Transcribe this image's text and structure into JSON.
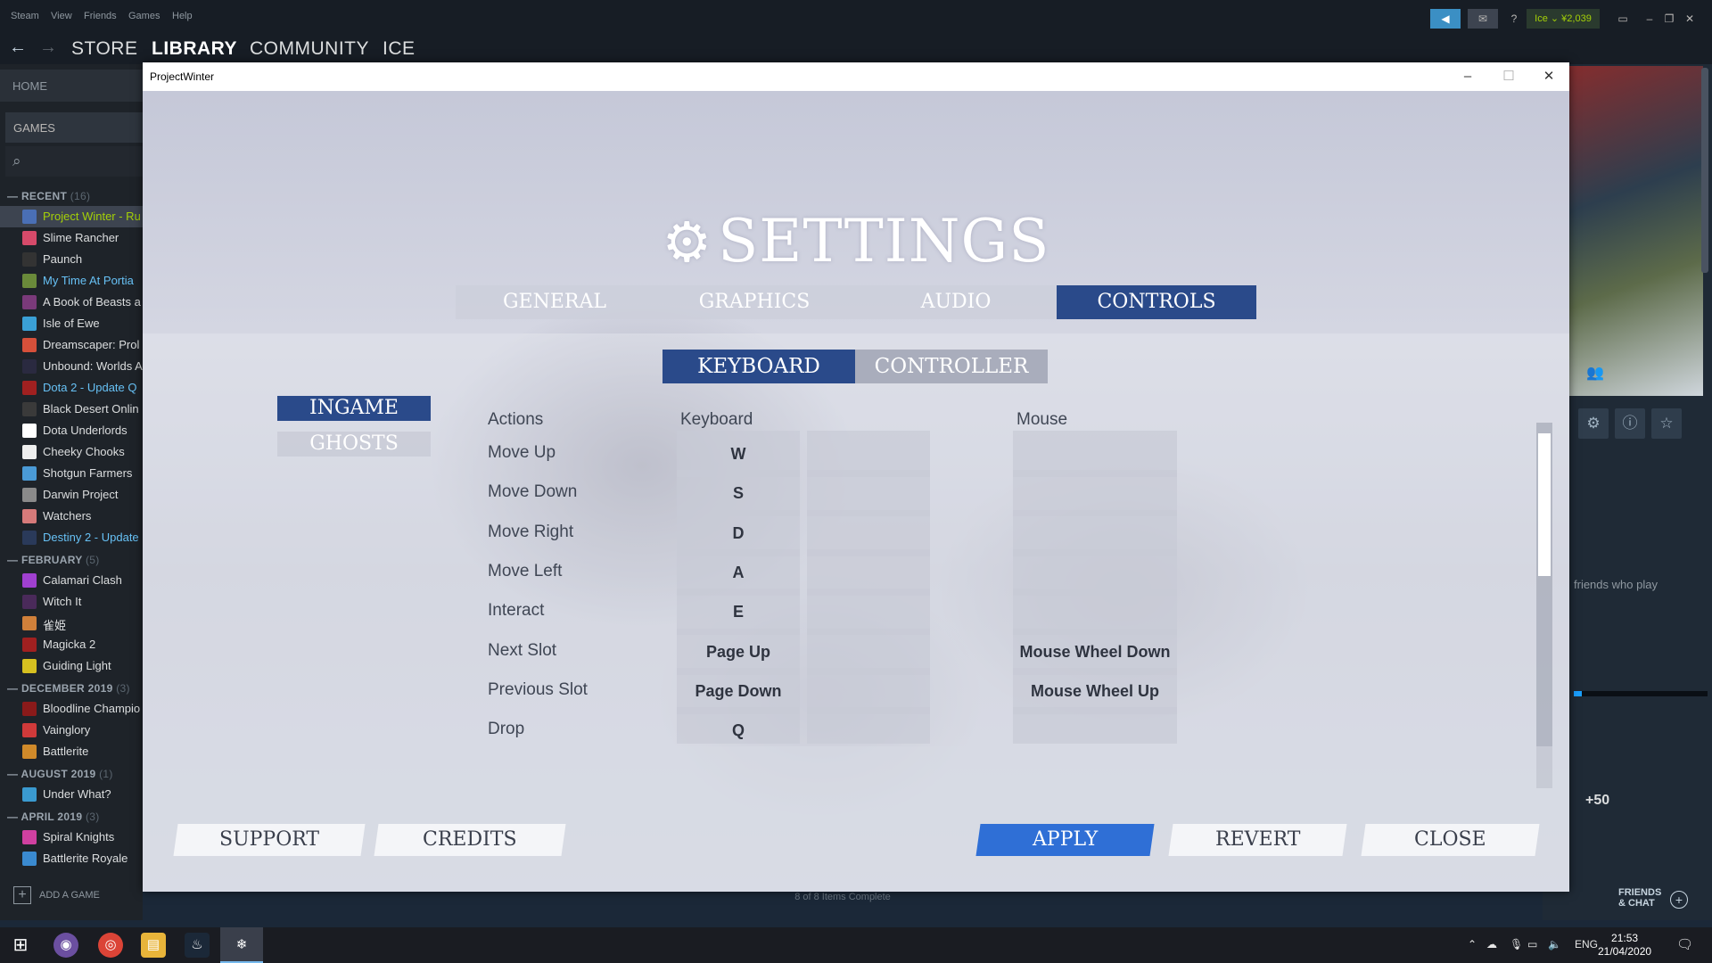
{
  "steam": {
    "menu": [
      "Steam",
      "View",
      "Friends",
      "Games",
      "Help"
    ],
    "nav": {
      "back": "←",
      "forward": "→",
      "store": "STORE",
      "library": "LIBRARY",
      "community": "COMMUNITY",
      "user": "ICE"
    },
    "account": {
      "help": "?",
      "user": "Ice ⌄ ¥2,039"
    },
    "window_controls": {
      "minimize": "–",
      "restore": "❐",
      "close": "✕"
    }
  },
  "sidebar": {
    "home": "HOME",
    "games": "GAMES",
    "search_icon": "⌕",
    "categories": [
      {
        "name": "RECENT",
        "count": "(16)",
        "games": [
          {
            "name": "Project Winter - Ru",
            "status": "running",
            "color": "#4a6fb5"
          },
          {
            "name": "Slime Rancher",
            "status": "",
            "color": "#d64a6a"
          },
          {
            "name": "Paunch",
            "status": "",
            "color": "#333333"
          },
          {
            "name": "My Time At Portia",
            "status": "update",
            "color": "#6a8a3a"
          },
          {
            "name": "A Book of Beasts a",
            "status": "",
            "color": "#7a3a7a"
          },
          {
            "name": "Isle of Ewe",
            "status": "",
            "color": "#3aa0d6"
          },
          {
            "name": "Dreamscaper: Prol",
            "status": "",
            "color": "#d6503a"
          },
          {
            "name": "Unbound: Worlds A",
            "status": "",
            "color": "#2a2a40"
          },
          {
            "name": "Dota 2 - Update Q",
            "status": "update",
            "color": "#a02020"
          },
          {
            "name": "Black Desert Onlin",
            "status": "",
            "color": "#3a3a3a"
          },
          {
            "name": "Dota Underlords",
            "status": "",
            "color": "#ffffff"
          },
          {
            "name": "Cheeky Chooks",
            "status": "",
            "color": "#eeeeee"
          },
          {
            "name": "Shotgun Farmers",
            "status": "",
            "color": "#4a9ad6"
          },
          {
            "name": "Darwin Project",
            "status": "",
            "color": "#8a8a8a"
          },
          {
            "name": "Watchers",
            "status": "",
            "color": "#d67a7a"
          },
          {
            "name": "Destiny 2 - Update",
            "status": "update",
            "color": "#2a3a5a"
          }
        ]
      },
      {
        "name": "FEBRUARY",
        "count": "(5)",
        "games": [
          {
            "name": "Calamari Clash",
            "status": "",
            "color": "#a040d0"
          },
          {
            "name": "Witch It",
            "status": "",
            "color": "#4a2a5a"
          },
          {
            "name": "雀姫",
            "status": "",
            "color": "#d0803a"
          },
          {
            "name": "Magicka 2",
            "status": "",
            "color": "#a02020"
          },
          {
            "name": "Guiding Light",
            "status": "",
            "color": "#d6c020"
          }
        ]
      },
      {
        "name": "DECEMBER 2019",
        "count": "(3)",
        "games": [
          {
            "name": "Bloodline Champio",
            "status": "",
            "color": "#8a1a1a"
          },
          {
            "name": "Vainglory",
            "status": "",
            "color": "#d03a3a"
          },
          {
            "name": "Battlerite",
            "status": "",
            "color": "#d08a2a"
          }
        ]
      },
      {
        "name": "AUGUST 2019",
        "count": "(1)",
        "games": [
          {
            "name": "Under What?",
            "status": "",
            "color": "#3a9ad0"
          }
        ]
      },
      {
        "name": "APRIL 2019",
        "count": "(3)",
        "games": [
          {
            "name": "Spiral Knights",
            "status": "",
            "color": "#d040a0"
          },
          {
            "name": "Battlerite Royale",
            "status": "",
            "color": "#3a8ad0"
          }
        ]
      }
    ],
    "add_game": "ADD A GAME"
  },
  "right_pane": {
    "friends_who_play": "friends who play",
    "plus_count": "+50",
    "friends_chat_line1": "FRIENDS",
    "friends_chat_line2": "& CHAT",
    "download_progress": 0.06
  },
  "status_bar": "8 of 8 Items Complete",
  "game_window": {
    "title": "ProjectWinter",
    "controls": {
      "minimize": "–",
      "maximize": "☐",
      "close": "✕"
    },
    "settings_title": "SETTINGS",
    "gear_icon": "⚙",
    "tabs": [
      "GENERAL",
      "GRAPHICS",
      "AUDIO",
      "CONTROLS"
    ],
    "active_tab": "CONTROLS",
    "subtabs": [
      "KEYBOARD",
      "CONTROLLER"
    ],
    "active_subtab": "KEYBOARD",
    "sidetabs": [
      "INGAME",
      "GHOSTS"
    ],
    "active_sidetab": "INGAME",
    "columns": {
      "actions": "Actions",
      "keyboard": "Keyboard",
      "mouse": "Mouse"
    },
    "bindings": [
      {
        "action": "Move Up",
        "key": "W",
        "alt": "",
        "mouse": ""
      },
      {
        "action": "Move Down",
        "key": "S",
        "alt": "",
        "mouse": ""
      },
      {
        "action": "Move Right",
        "key": "D",
        "alt": "",
        "mouse": ""
      },
      {
        "action": "Move Left",
        "key": "A",
        "alt": "",
        "mouse": ""
      },
      {
        "action": "Interact",
        "key": "E",
        "alt": "",
        "mouse": ""
      },
      {
        "action": "Next Slot",
        "key": "Page Up",
        "alt": "",
        "mouse": "Mouse Wheel Down"
      },
      {
        "action": "Previous Slot",
        "key": "Page Down",
        "alt": "",
        "mouse": "Mouse Wheel Up"
      },
      {
        "action": "Drop",
        "key": "Q",
        "alt": "",
        "mouse": ""
      }
    ],
    "buttons": {
      "support": "SUPPORT",
      "credits": "CREDITS",
      "apply": "APPLY",
      "revert": "REVERT",
      "close": "CLOSE"
    }
  },
  "taskbar": {
    "start_icon": "⊞",
    "tray": {
      "lang": "ENG",
      "time": "21:53",
      "date": "21/04/2020",
      "notif": "1"
    }
  }
}
